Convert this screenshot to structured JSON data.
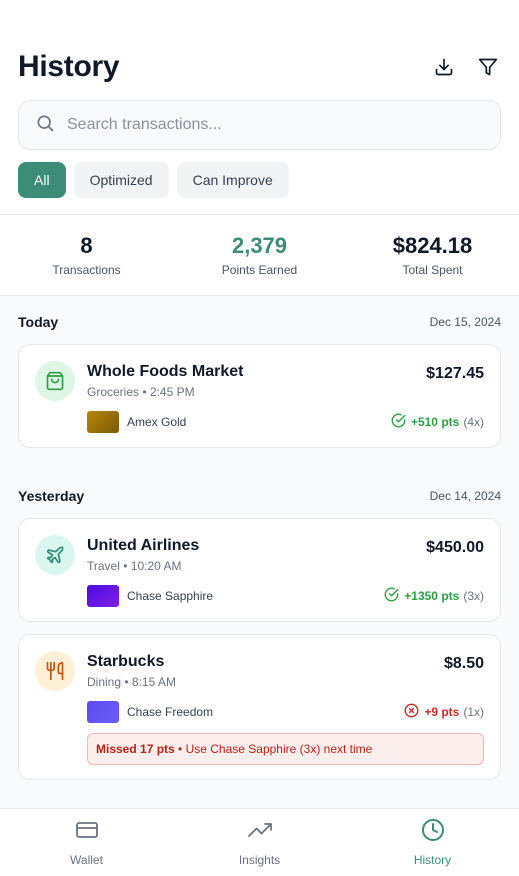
{
  "header": {
    "title": "History",
    "download_icon": "download-icon",
    "filter_icon": "filter-icon"
  },
  "search": {
    "placeholder": "Search transactions...",
    "value": ""
  },
  "filters": [
    {
      "label": "All",
      "active": true
    },
    {
      "label": "Optimized",
      "active": false
    },
    {
      "label": "Can Improve",
      "active": false
    }
  ],
  "stats": [
    {
      "value": "8",
      "label": "Transactions"
    },
    {
      "value": "2,379",
      "label": "Points Earned"
    },
    {
      "value": "$824.18",
      "label": "Total Spent"
    }
  ],
  "sections": [
    {
      "title": "Today",
      "date": "Dec 15, 2024",
      "transactions": [
        {
          "merchant": "Whole Foods Market",
          "category": "Groceries",
          "time": "2:45 PM",
          "amount": "$127.45",
          "card": "Amex Gold",
          "points": "+510 pts",
          "multiplier": "(4x)",
          "status": "good",
          "icon": "shopping-bag-icon"
        }
      ]
    },
    {
      "title": "Yesterday",
      "date": "Dec 14, 2024",
      "transactions": [
        {
          "merchant": "United Airlines",
          "category": "Travel",
          "time": "10:20 AM",
          "amount": "$450.00",
          "card": "Chase Sapphire",
          "points": "+1350 pts",
          "multiplier": "(3x)",
          "status": "good",
          "icon": "plane-icon"
        },
        {
          "merchant": "Starbucks",
          "category": "Dining",
          "time": "8:15 AM",
          "amount": "$8.50",
          "card": "Chase Freedom",
          "points": "+9 pts",
          "multiplier": "(1x)",
          "status": "bad",
          "icon": "utensils-icon",
          "missed_strong": "Missed 17 pts",
          "missed_text": "• Use Chase Sapphire (3x) next time"
        }
      ]
    }
  ],
  "tabs": [
    {
      "label": "Wallet",
      "icon": "credit-card-icon",
      "active": false
    },
    {
      "label": "Insights",
      "icon": "trending-up-icon",
      "active": false
    },
    {
      "label": "History",
      "icon": "clock-icon",
      "active": true
    }
  ],
  "colors": {
    "accent": "#3d8c78",
    "positive": "#2f9e44",
    "negative": "#c92a2a"
  }
}
